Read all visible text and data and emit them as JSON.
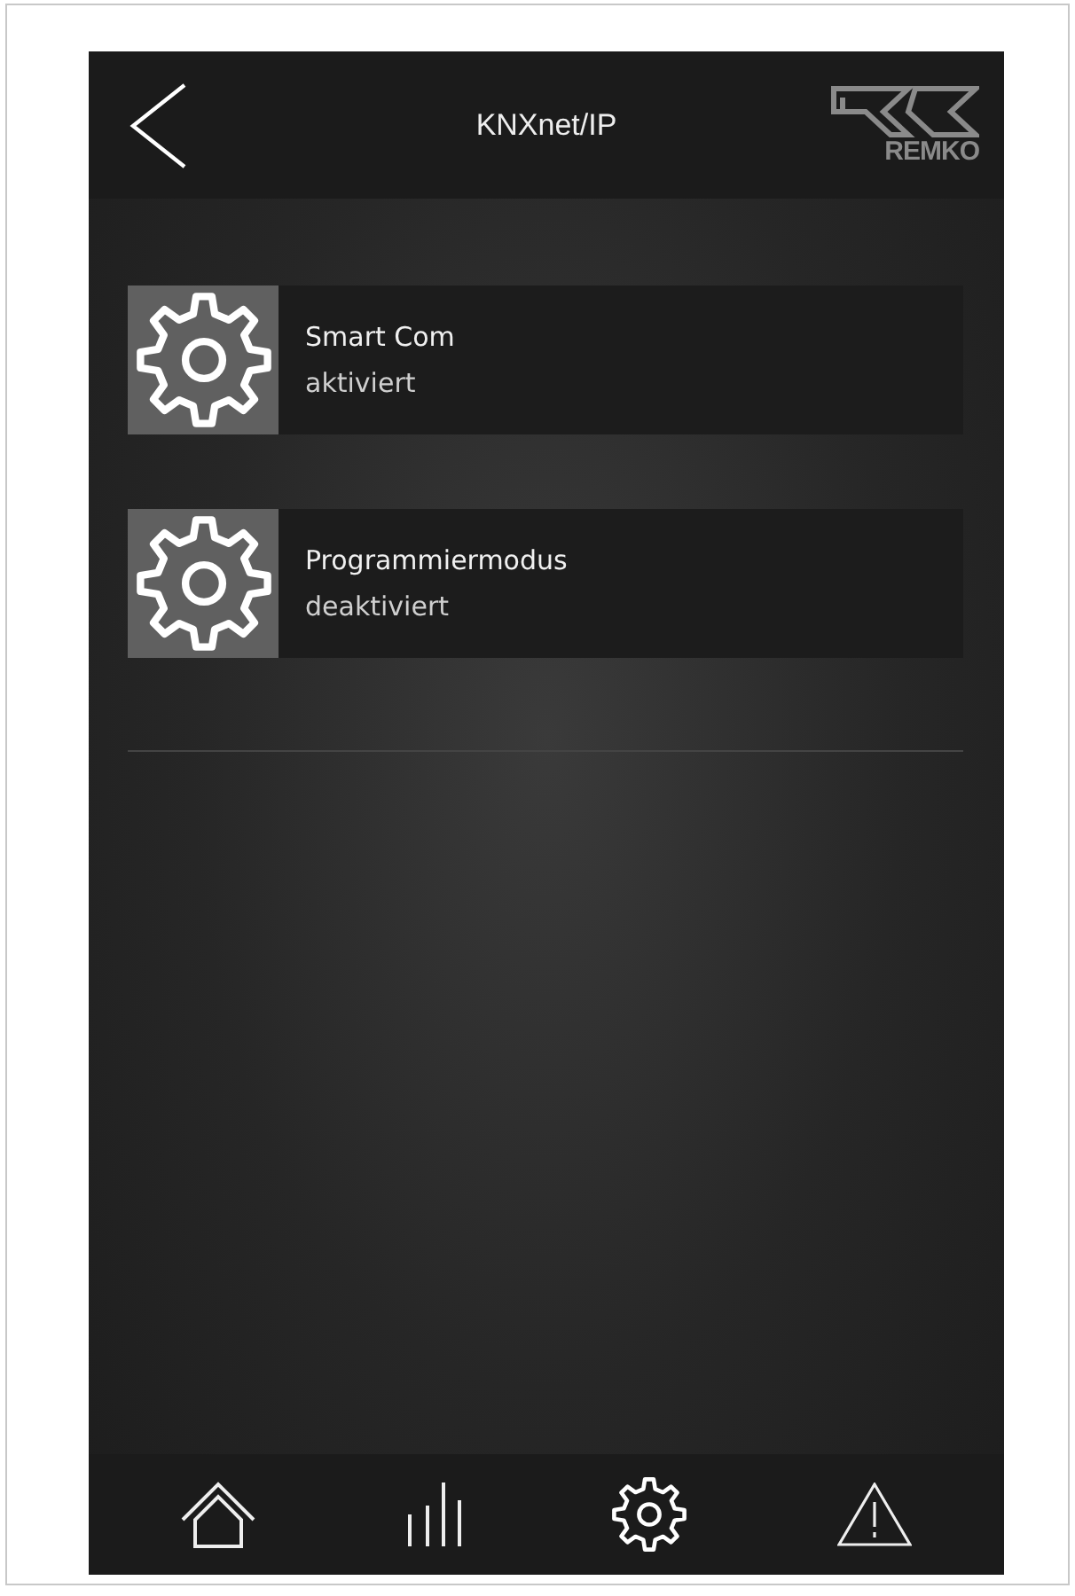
{
  "header": {
    "title": "KNXnet/IP",
    "logo_text": "REMKO"
  },
  "items": [
    {
      "title": "Smart Com",
      "status": "aktiviert"
    },
    {
      "title": "Programmiermodus",
      "status": "deaktiviert"
    }
  ],
  "nav": [
    {
      "kind": "home"
    },
    {
      "kind": "chart"
    },
    {
      "kind": "settings"
    },
    {
      "kind": "warning"
    }
  ]
}
